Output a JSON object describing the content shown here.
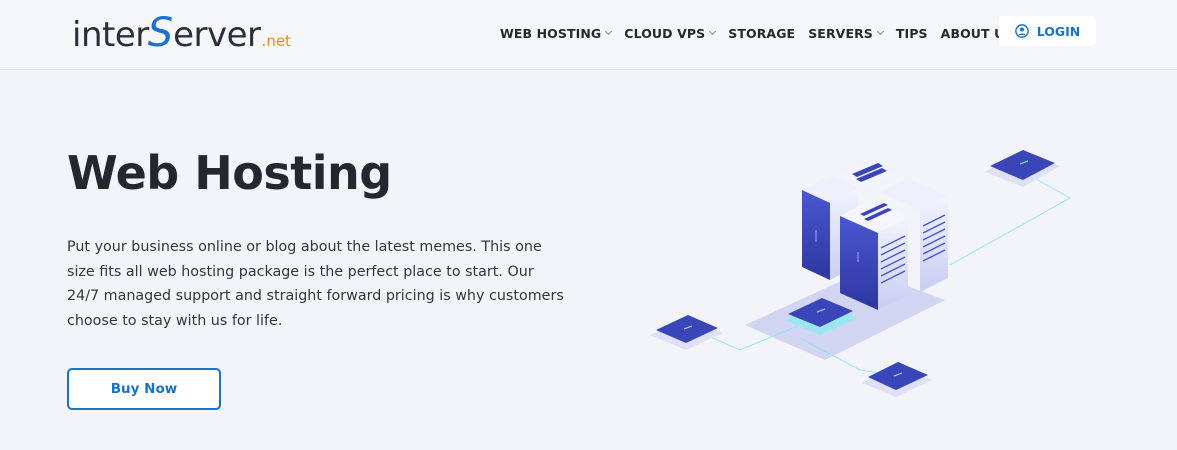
{
  "header": {
    "logo": {
      "part1": "inter",
      "part2": "S",
      "part3": "erver",
      "part4": ".net"
    },
    "nav": [
      {
        "label": "WEB HOSTING",
        "dropdown": true
      },
      {
        "label": "CLOUD VPS",
        "dropdown": true
      },
      {
        "label": "STORAGE",
        "dropdown": false
      },
      {
        "label": "SERVERS",
        "dropdown": true
      },
      {
        "label": "TIPS",
        "dropdown": false
      },
      {
        "label": "ABOUT US",
        "dropdown": true
      }
    ],
    "login_label": "LOGIN",
    "login_icon": "user-circle-icon"
  },
  "hero": {
    "title": "Web Hosting",
    "description": "Put your business online or blog about the latest memes. This one size fits all web hosting package is the perfect place to start. Our 24/7 managed support and straight forward pricing is why customers choose to stay with us for life.",
    "button_label": "Buy Now",
    "illustration_icon": "server-rack-illustration"
  },
  "colors": {
    "accent": "#1a73c2",
    "logo_orange": "#f08a1c",
    "background": "#f3f4f9",
    "server_blue": "#3a45b8"
  }
}
